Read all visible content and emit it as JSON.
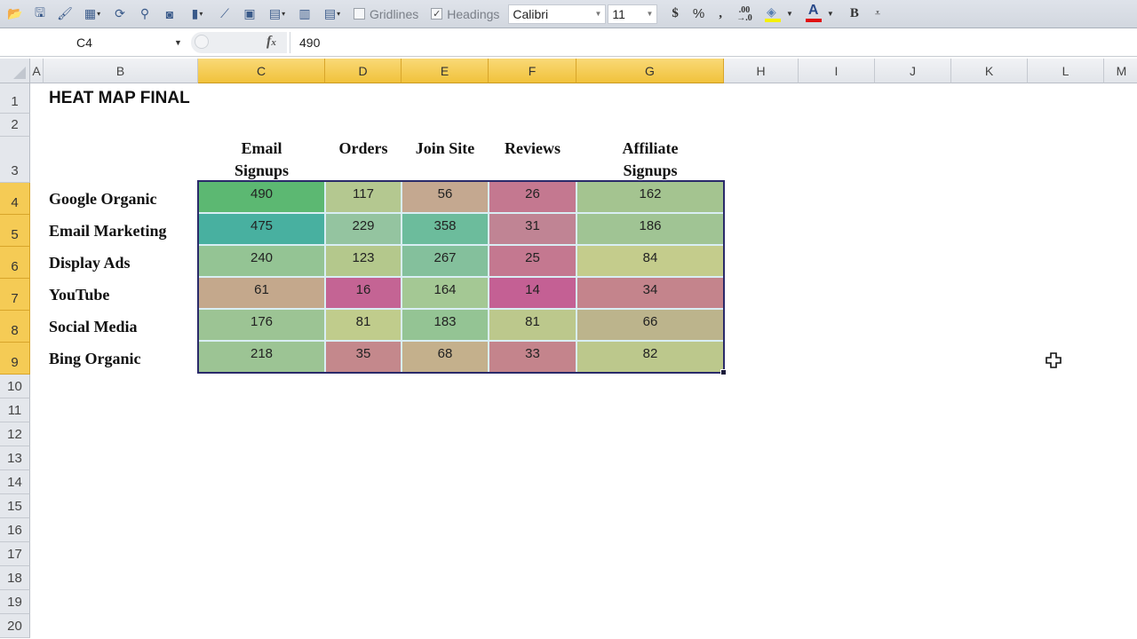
{
  "toolbar": {
    "buttons": [
      {
        "name": "open-icon",
        "glyph": "📂"
      },
      {
        "name": "save-icon",
        "glyph": "🖫"
      },
      {
        "name": "format-painter-icon",
        "glyph": "🖌"
      },
      {
        "name": "table-icon",
        "glyph": "▦",
        "dropdown": true
      },
      {
        "name": "refresh-icon",
        "glyph": "⟳"
      },
      {
        "name": "filter-icon",
        "glyph": "⚲"
      },
      {
        "name": "camera-icon",
        "glyph": "◙"
      },
      {
        "name": "chart-icon",
        "glyph": "▮",
        "dropdown": true
      },
      {
        "name": "line-chart-icon",
        "glyph": "⟋"
      },
      {
        "name": "pivot-icon",
        "glyph": "▣"
      },
      {
        "name": "table-style-icon",
        "glyph": "▤",
        "dropdown": true
      },
      {
        "name": "paste-icon",
        "glyph": "▥"
      },
      {
        "name": "cell-style-icon",
        "glyph": "▤",
        "dropdown": true
      }
    ],
    "gridlines_label": "Gridlines",
    "gridlines_checked": false,
    "headings_label": "Headings",
    "headings_checked": true,
    "font_name": "Calibri",
    "font_size": "11",
    "currency_label": "$",
    "percent_label": "%",
    "comma_label": ",",
    "decimal_label": ".00→.0",
    "bold_label": "B",
    "fill_color": "#f5f000",
    "font_color": "#e01010"
  },
  "formula_bar": {
    "name_box": "C4",
    "fx_label": "fx",
    "formula": "490"
  },
  "columns": [
    "A",
    "B",
    "C",
    "D",
    "E",
    "F",
    "G",
    "H",
    "I",
    "J",
    "K",
    "L",
    "M"
  ],
  "selected_columns": [
    "C",
    "D",
    "E",
    "F",
    "G"
  ],
  "rows": [
    "1",
    "2",
    "3",
    "4",
    "5",
    "6",
    "7",
    "8",
    "9",
    "10",
    "11",
    "12",
    "13",
    "14",
    "15",
    "16",
    "17",
    "18",
    "19",
    "20"
  ],
  "selected_rows": [
    "4",
    "5",
    "6",
    "7",
    "8",
    "9"
  ],
  "sheet": {
    "title": "HEAT MAP FINAL",
    "headers": [
      {
        "line1": "Email",
        "line2": "Signups"
      },
      {
        "line1": "Orders",
        "line2": ""
      },
      {
        "line1": "Join Site",
        "line2": ""
      },
      {
        "line1": "Reviews",
        "line2": ""
      },
      {
        "line1": "Affiliate",
        "line2": "Signups"
      }
    ],
    "row_labels": [
      "Google Organic",
      "Email Marketing",
      "Display Ads",
      "YouTube",
      "Social Media",
      "Bing Organic"
    ],
    "values": [
      [
        "490",
        "117",
        "56",
        "26",
        "162"
      ],
      [
        "475",
        "229",
        "358",
        "31",
        "186"
      ],
      [
        "240",
        "123",
        "267",
        "25",
        "84"
      ],
      [
        "61",
        "16",
        "164",
        "14",
        "34"
      ],
      [
        "176",
        "81",
        "183",
        "81",
        "66"
      ],
      [
        "218",
        "35",
        "68",
        "33",
        "82"
      ]
    ],
    "colors": [
      [
        "#5cb872",
        "#b4c890",
        "#c4a890",
        "#c47890",
        "#a4c490"
      ],
      [
        "#48b0a0",
        "#94c4a0",
        "#6cbc9c",
        "#c08494",
        "#a0c494"
      ],
      [
        "#94c494",
        "#b4c88c",
        "#84c09c",
        "#c47890",
        "#c4cc8c"
      ],
      [
        "#c4a88c",
        "#c46494",
        "#a4c894",
        "#c46094",
        "#c4848c"
      ],
      [
        "#9cc494",
        "#c0cc8c",
        "#94c494",
        "#bcc88c",
        "#bcb48c"
      ],
      [
        "#9cc494",
        "#c4888c",
        "#c4b08c",
        "#c4848c",
        "#bcc88c"
      ]
    ]
  }
}
